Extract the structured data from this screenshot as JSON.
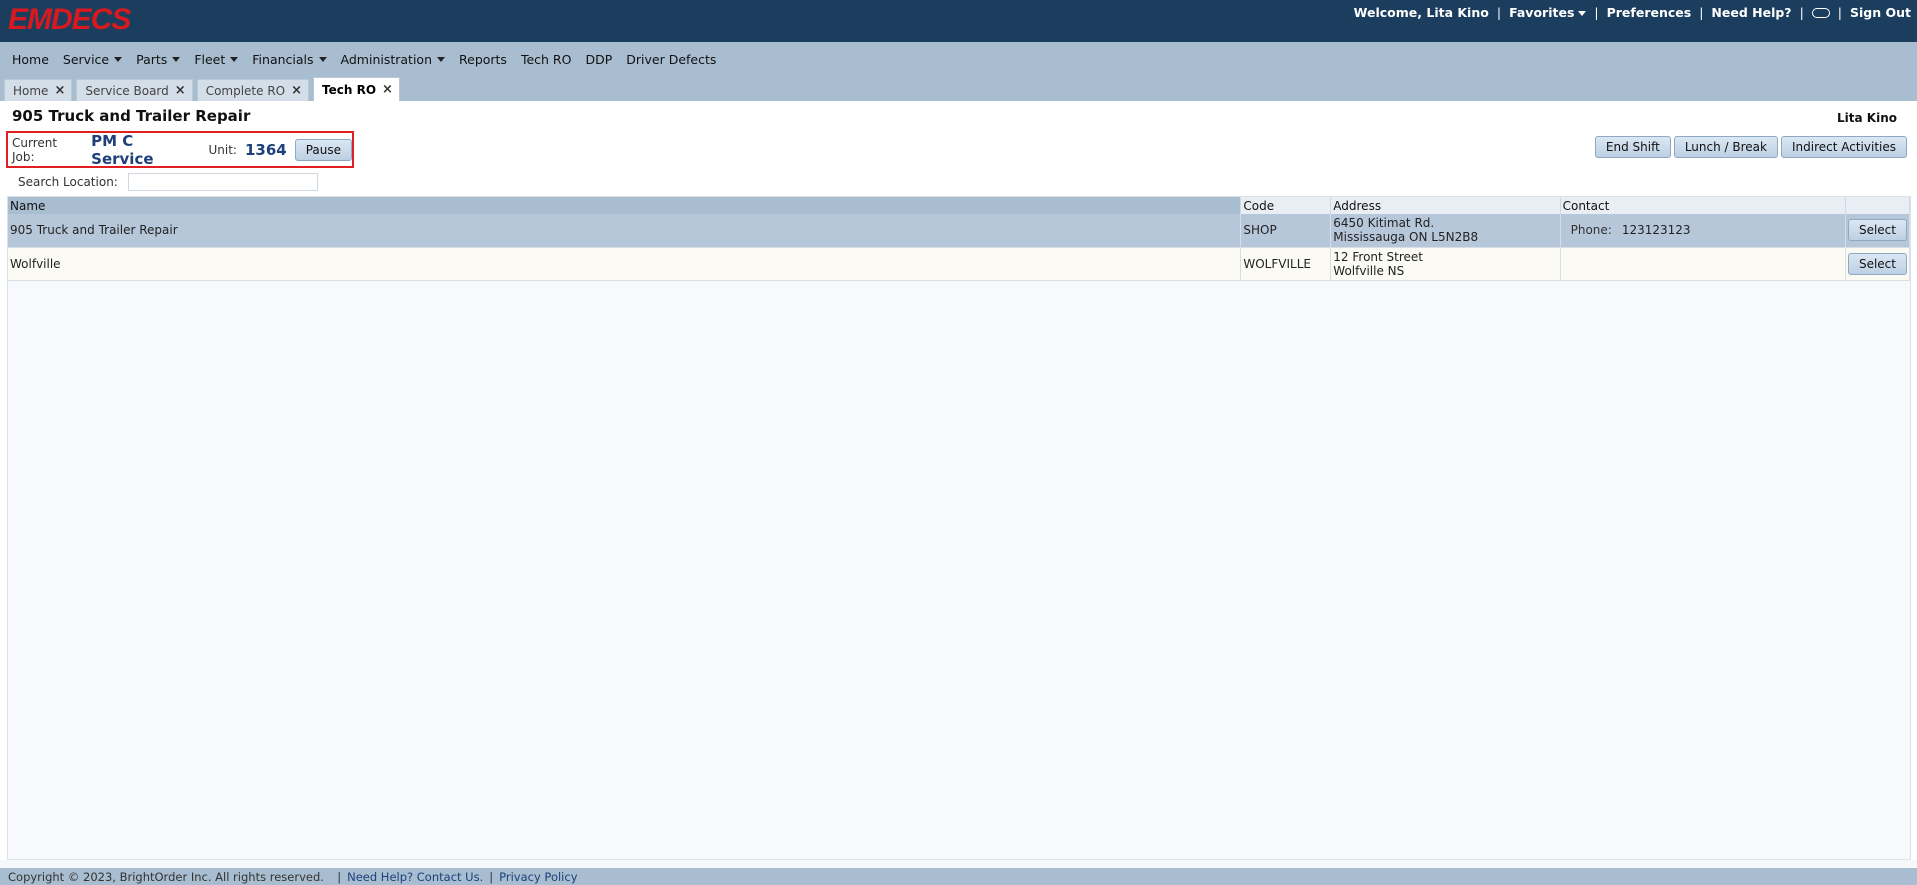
{
  "app": {
    "logo_text": "EMDECS"
  },
  "topbar": {
    "welcome": "Welcome, Lita Kino",
    "favorites": "Favorites",
    "preferences": "Preferences",
    "need_help": "Need Help?",
    "sign_out": "Sign Out"
  },
  "menu": {
    "items": [
      {
        "label": "Home"
      },
      {
        "label": "Service"
      },
      {
        "label": "Parts"
      },
      {
        "label": "Fleet"
      },
      {
        "label": "Financials"
      },
      {
        "label": "Administration"
      },
      {
        "label": "Reports"
      },
      {
        "label": "Tech RO"
      },
      {
        "label": "DDP"
      },
      {
        "label": "Driver Defects"
      }
    ]
  },
  "tabs": [
    {
      "label": "Home"
    },
    {
      "label": "Service Board"
    },
    {
      "label": "Complete RO"
    },
    {
      "label": "Tech RO",
      "active": true
    }
  ],
  "page": {
    "title": "905 Truck and Trailer Repair",
    "user": "Lita Kino",
    "current_job_label": "Current Job:",
    "current_job": "PM C Service",
    "unit_label": "Unit:",
    "unit": "1364",
    "pause": "Pause",
    "end_shift": "End Shift",
    "lunch_break": "Lunch / Break",
    "indirect": "Indirect Activities",
    "search_label": "Search Location:",
    "search_value": ""
  },
  "grid": {
    "headers": {
      "name": "Name",
      "code": "Code",
      "address": "Address",
      "contact": "Contact"
    },
    "rows": [
      {
        "name": "905 Truck and Trailer Repair",
        "code": "SHOP",
        "address1": "6450 Kitimat Rd.",
        "address2": "Mississauga ON L5N2B8",
        "phone_label": "Phone:",
        "phone": "123123123",
        "select": "Select"
      },
      {
        "name": "Wolfville",
        "code": "WOLFVILLE",
        "address1": "12 Front Street",
        "address2": "Wolfville NS",
        "phone_label": "",
        "phone": "",
        "select": "Select"
      }
    ]
  },
  "footer": {
    "copyright": "Copyright © 2023, BrightOrder Inc. All rights reserved.",
    "contact": "Need Help? Contact Us.",
    "privacy": "Privacy Policy"
  },
  "colors": {
    "header_bg": "#1b3e5f",
    "menu_bg": "#a9bdd1",
    "logo": "#d71920",
    "highlight": "#e02020"
  }
}
